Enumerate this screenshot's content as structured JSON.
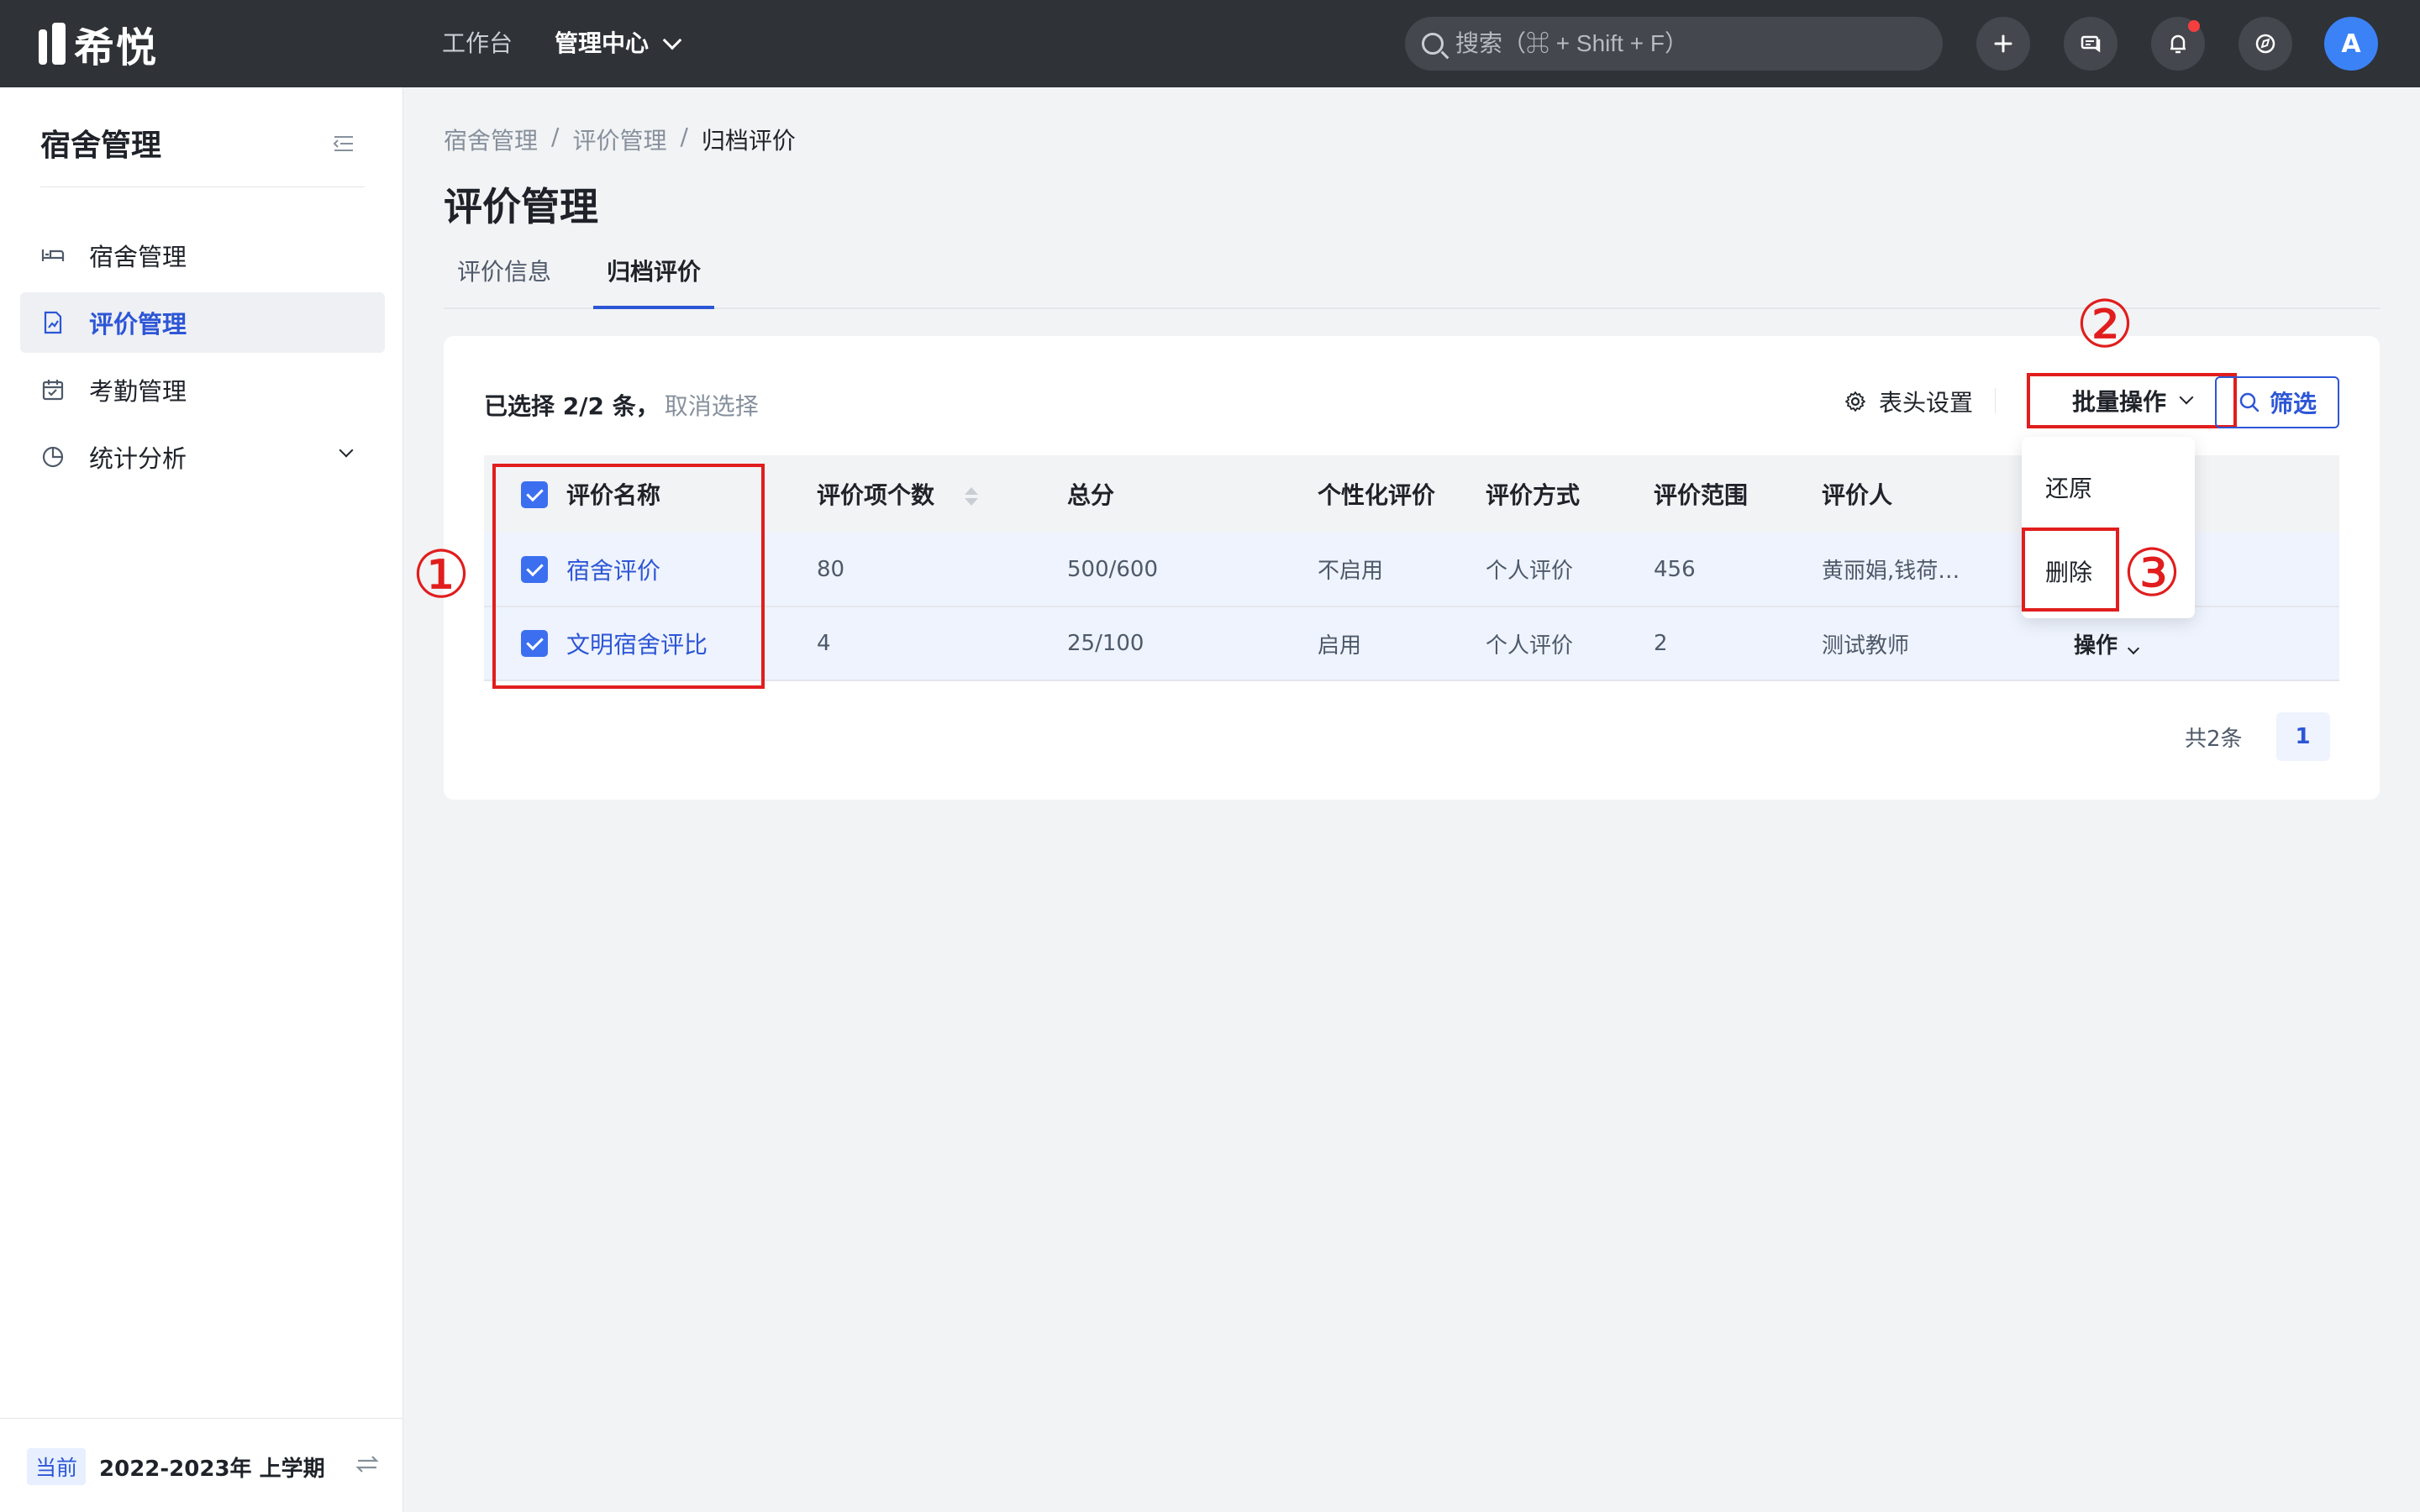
{
  "app": {
    "logo_text": "希悦",
    "nav": [
      "工作台",
      "管理中心"
    ],
    "search_placeholder": "搜索（⌘ + Shift + F）",
    "avatar": "A",
    "add_icon": "plus-icon",
    "accent": "#2d56d6"
  },
  "sidebar": {
    "title": "宿舍管理",
    "items": [
      {
        "label": "宿舍管理",
        "icon": "bed-icon"
      },
      {
        "label": "评价管理",
        "icon": "chart-doc-icon"
      },
      {
        "label": "考勤管理",
        "icon": "calendar-icon"
      },
      {
        "label": "统计分析",
        "icon": "pie-icon"
      }
    ],
    "term_badge": "当前",
    "term": "2022-2023年 上学期"
  },
  "breadcrumb": [
    "宿舍管理",
    "/",
    "评价管理",
    "/",
    "归档评价"
  ],
  "page_title": "评价管理",
  "tabs": [
    "评价信息",
    "归档评价"
  ],
  "toolbar": {
    "selected_text": "已选择 2/2 条，",
    "cancel_text": "取消选择",
    "header_settings": "表头设置",
    "batch_ops": "批量操作",
    "filter": "筛选"
  },
  "table": {
    "columns": [
      "评价名称",
      "评价项个数",
      "总分",
      "个性化评价",
      "评价方式",
      "评价范围",
      "评价人"
    ],
    "rows": [
      {
        "name": "宿舍评价",
        "items": "80",
        "score": "500/600",
        "personal": "不启用",
        "mode": "个人评价",
        "range": "456",
        "evaluator": "黄丽娟,钱荷…",
        "action": ""
      },
      {
        "name": "文明宿舍评比",
        "items": "4",
        "score": "25/100",
        "personal": "启用",
        "mode": "个人评价",
        "range": "2",
        "evaluator": "测试教师",
        "action": "操作"
      }
    ]
  },
  "pagination": {
    "total": "共2条",
    "page": "1"
  },
  "dropdown": {
    "items": [
      "还原",
      "删除"
    ]
  },
  "annotations": [
    "①",
    "②",
    "③"
  ]
}
